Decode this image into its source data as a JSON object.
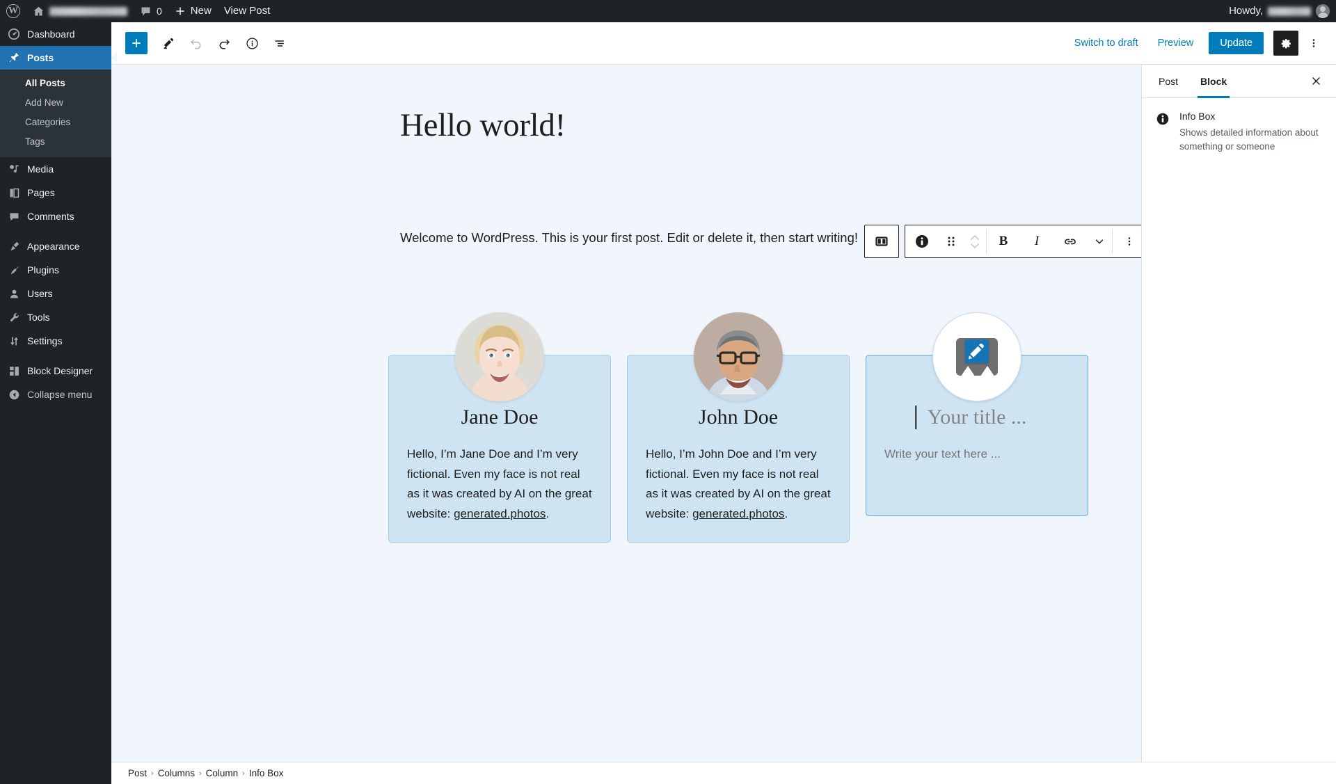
{
  "adminbar": {
    "wp_logo": "wordpress-logo",
    "site_name": "",
    "comments_count": "0",
    "new_label": "New",
    "view_post_label": "View Post",
    "howdy_label": "Howdy,",
    "user_name": ""
  },
  "adminmenu": {
    "items": [
      {
        "label": "Dashboard",
        "icon": "dashboard-icon",
        "current": false
      },
      {
        "label": "Posts",
        "icon": "pin-icon",
        "current": true
      },
      {
        "label": "Media",
        "icon": "media-icon",
        "current": false
      },
      {
        "label": "Pages",
        "icon": "pages-icon",
        "current": false
      },
      {
        "label": "Comments",
        "icon": "comments-icon",
        "current": false
      },
      {
        "label": "Appearance",
        "icon": "appearance-brush-icon",
        "current": false
      },
      {
        "label": "Plugins",
        "icon": "plugins-plug-icon",
        "current": false
      },
      {
        "label": "Users",
        "icon": "users-icon",
        "current": false
      },
      {
        "label": "Tools",
        "icon": "tools-wrench-icon",
        "current": false
      },
      {
        "label": "Settings",
        "icon": "settings-sliders-icon",
        "current": false
      },
      {
        "label": "Block Designer",
        "icon": "block-designer-icon",
        "current": false
      },
      {
        "label": "Collapse menu",
        "icon": "collapse-arrow-icon",
        "current": false
      }
    ],
    "submenu": [
      {
        "label": "All Posts",
        "current": true
      },
      {
        "label": "Add New",
        "current": false
      },
      {
        "label": "Categories",
        "current": false
      },
      {
        "label": "Tags",
        "current": false
      }
    ]
  },
  "editor_header": {
    "add_block_label": "+",
    "tools_icon": "pencil-tools-icon",
    "undo_icon": "undo-icon",
    "redo_icon": "redo-icon",
    "details_icon": "info-details-icon",
    "list_view_icon": "list-view-icon",
    "switch_to_draft_label": "Switch to draft",
    "preview_label": "Preview",
    "update_label": "Update",
    "settings_icon": "gear-icon",
    "more_options_icon": "kebab-menu-icon"
  },
  "post": {
    "title": "Hello world!",
    "intro": "Welcome to WordPress. This is your first post. Edit or delete it, then start writing!"
  },
  "columns": [
    {
      "selected": false,
      "avatar": "photo-woman-blonde",
      "name": "Jane Doe",
      "text_before_link": "Hello, I’m Jane Doe and I’m very fictional. Even my face is not real as it was created by AI on the great website: ",
      "link_text": "generated.photos",
      "text_after_link": "."
    },
    {
      "selected": false,
      "avatar": "photo-man-glasses",
      "name": "John Doe",
      "text_before_link": "Hello, I’m John Doe and I’m very fictional. Even my face is not real as it was created by AI on the great website: ",
      "link_text": "generated.photos",
      "text_after_link": "."
    },
    {
      "selected": true,
      "avatar": "image-placeholder-icon",
      "edit_badge_icon": "pencil-edit-icon",
      "name": "Your title ...",
      "text_before_link": "Write your text here ...",
      "link_text": "",
      "text_after_link": ""
    }
  ],
  "block_toolbar": {
    "parent_block_icon": "columns-block-icon",
    "block_type_icon": "info-box-icon",
    "drag_handle_icon": "drag-handle-icon",
    "move_up_icon": "chevron-up-icon",
    "move_down_icon": "chevron-down-icon",
    "bold_label": "B",
    "italic_label": "I",
    "link_icon": "link-icon",
    "more_rich_text_icon": "chevron-down-icon",
    "options_icon": "kebab-menu-icon"
  },
  "right_sidebar": {
    "tabs": [
      {
        "label": "Post",
        "active": false
      },
      {
        "label": "Block",
        "active": true
      }
    ],
    "close_icon": "close-icon",
    "block": {
      "icon": "info-box-icon",
      "name": "Info Box",
      "description": "Shows detailed information about something or someone"
    }
  },
  "breadcrumb": {
    "items": [
      "Post",
      "Columns",
      "Column",
      "Info Box"
    ],
    "separator": "›"
  },
  "colors": {
    "admin_dark": "#1d2327",
    "admin_submenu": "#2c3338",
    "accent_blue": "#007cba",
    "current_menu_blue": "#2271b1",
    "canvas_bg": "#f0f6fc",
    "infobox_bg": "#cfe4f3",
    "infobox_border": "#a5cbe8"
  }
}
